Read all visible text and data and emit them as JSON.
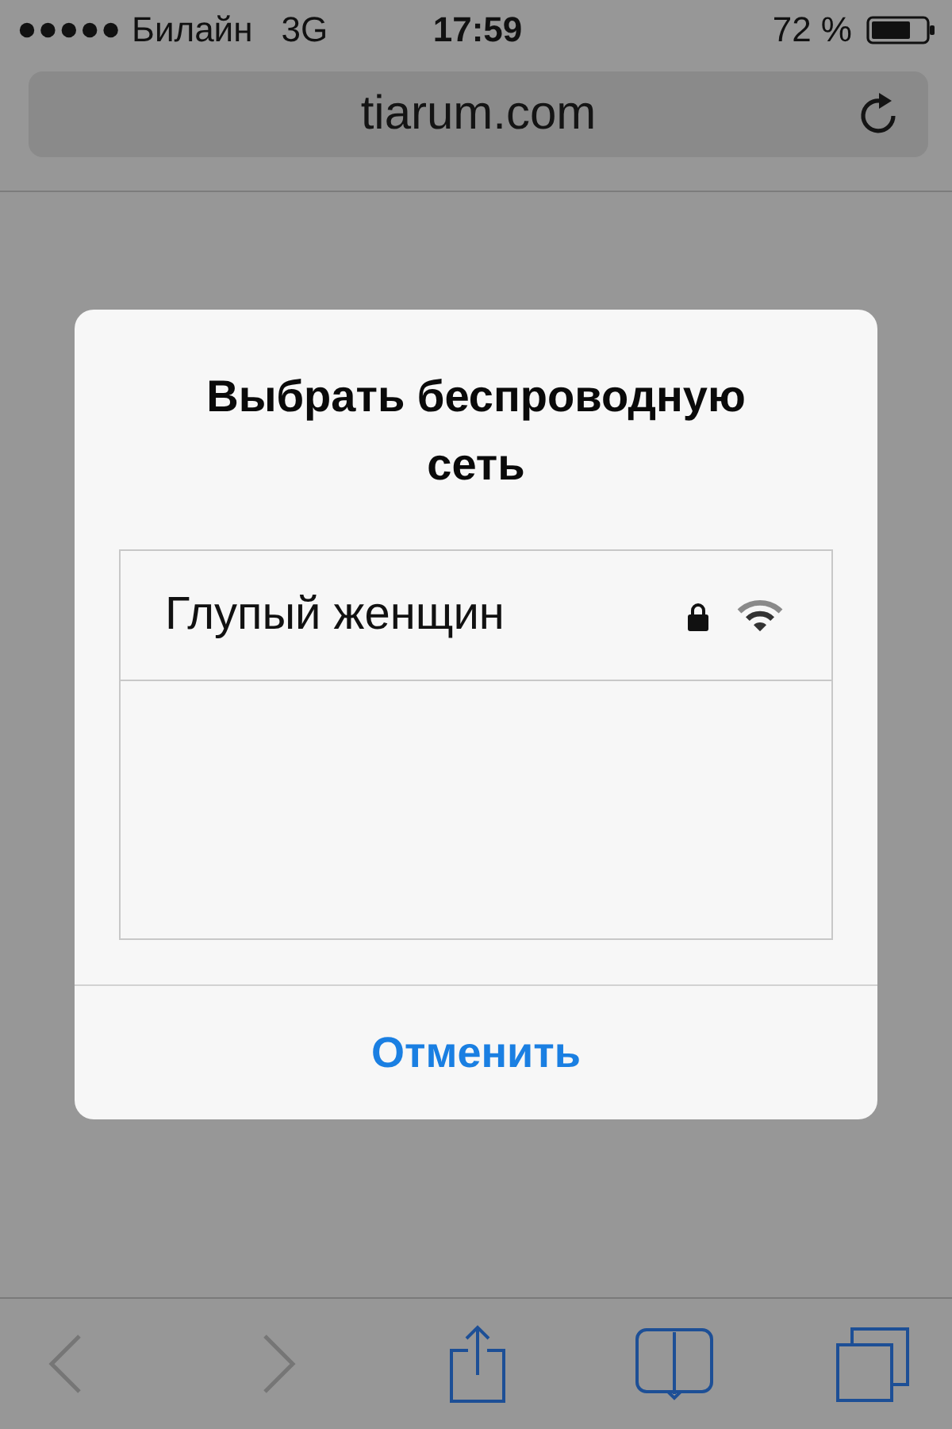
{
  "status_bar": {
    "carrier": "Билайн",
    "network": "3G",
    "time": "17:59",
    "battery": "72 %"
  },
  "address_bar": {
    "url": "tiarum.com"
  },
  "dialog": {
    "title": "Выбрать беспроводную сеть",
    "networks": [
      {
        "name": "Глупый женщин",
        "secured": true
      }
    ],
    "cancel": "Отменить"
  },
  "toolbar": [
    {
      "kind": "back",
      "disabled": true
    },
    {
      "kind": "forward",
      "disabled": true
    },
    {
      "kind": "share",
      "disabled": false
    },
    {
      "kind": "bookmarks",
      "disabled": false
    },
    {
      "kind": "tabs",
      "disabled": false
    }
  ]
}
